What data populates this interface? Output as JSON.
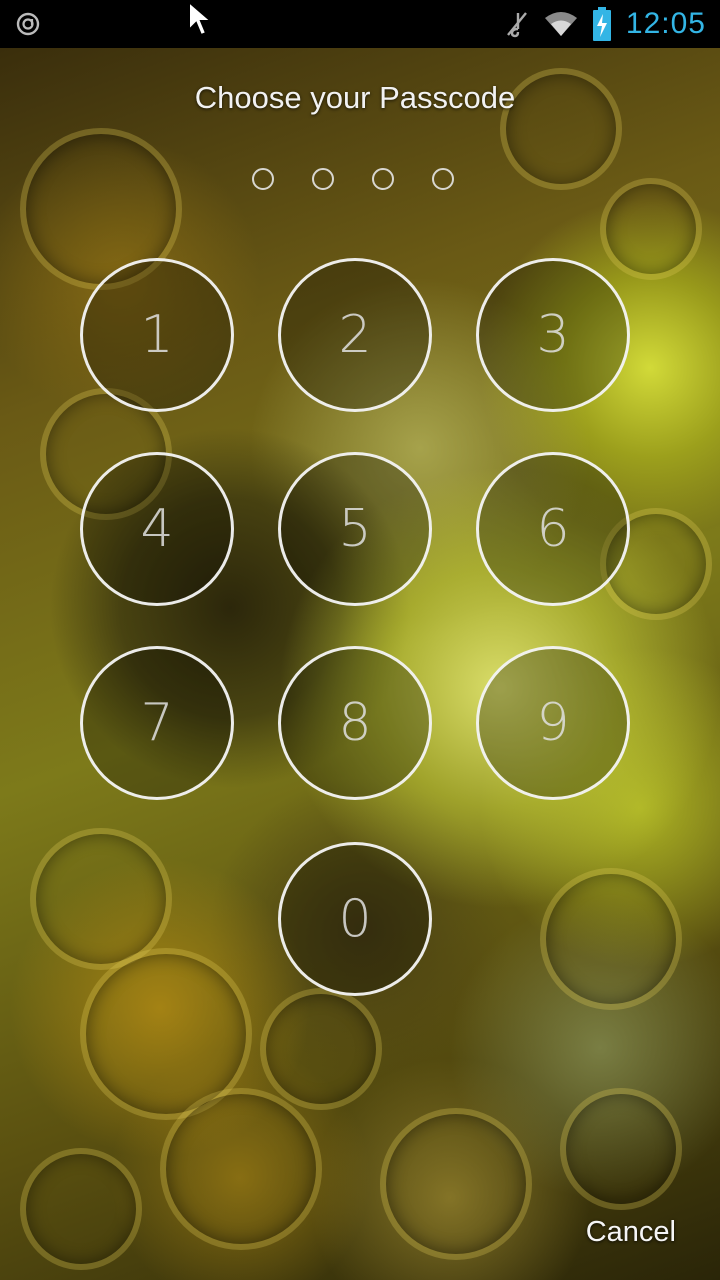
{
  "status_bar": {
    "time": "12:05",
    "icons": [
      "app-notification-icon",
      "mute-icon",
      "wifi-icon",
      "battery-charging-icon"
    ],
    "clock_color": "#33b5e5"
  },
  "lock_screen": {
    "title": "Choose your Passcode",
    "entered_digits": 0,
    "max_digits": 4,
    "keys": [
      "1",
      "2",
      "3",
      "4",
      "5",
      "6",
      "7",
      "8",
      "9",
      "0"
    ],
    "cancel_label": "Cancel"
  }
}
